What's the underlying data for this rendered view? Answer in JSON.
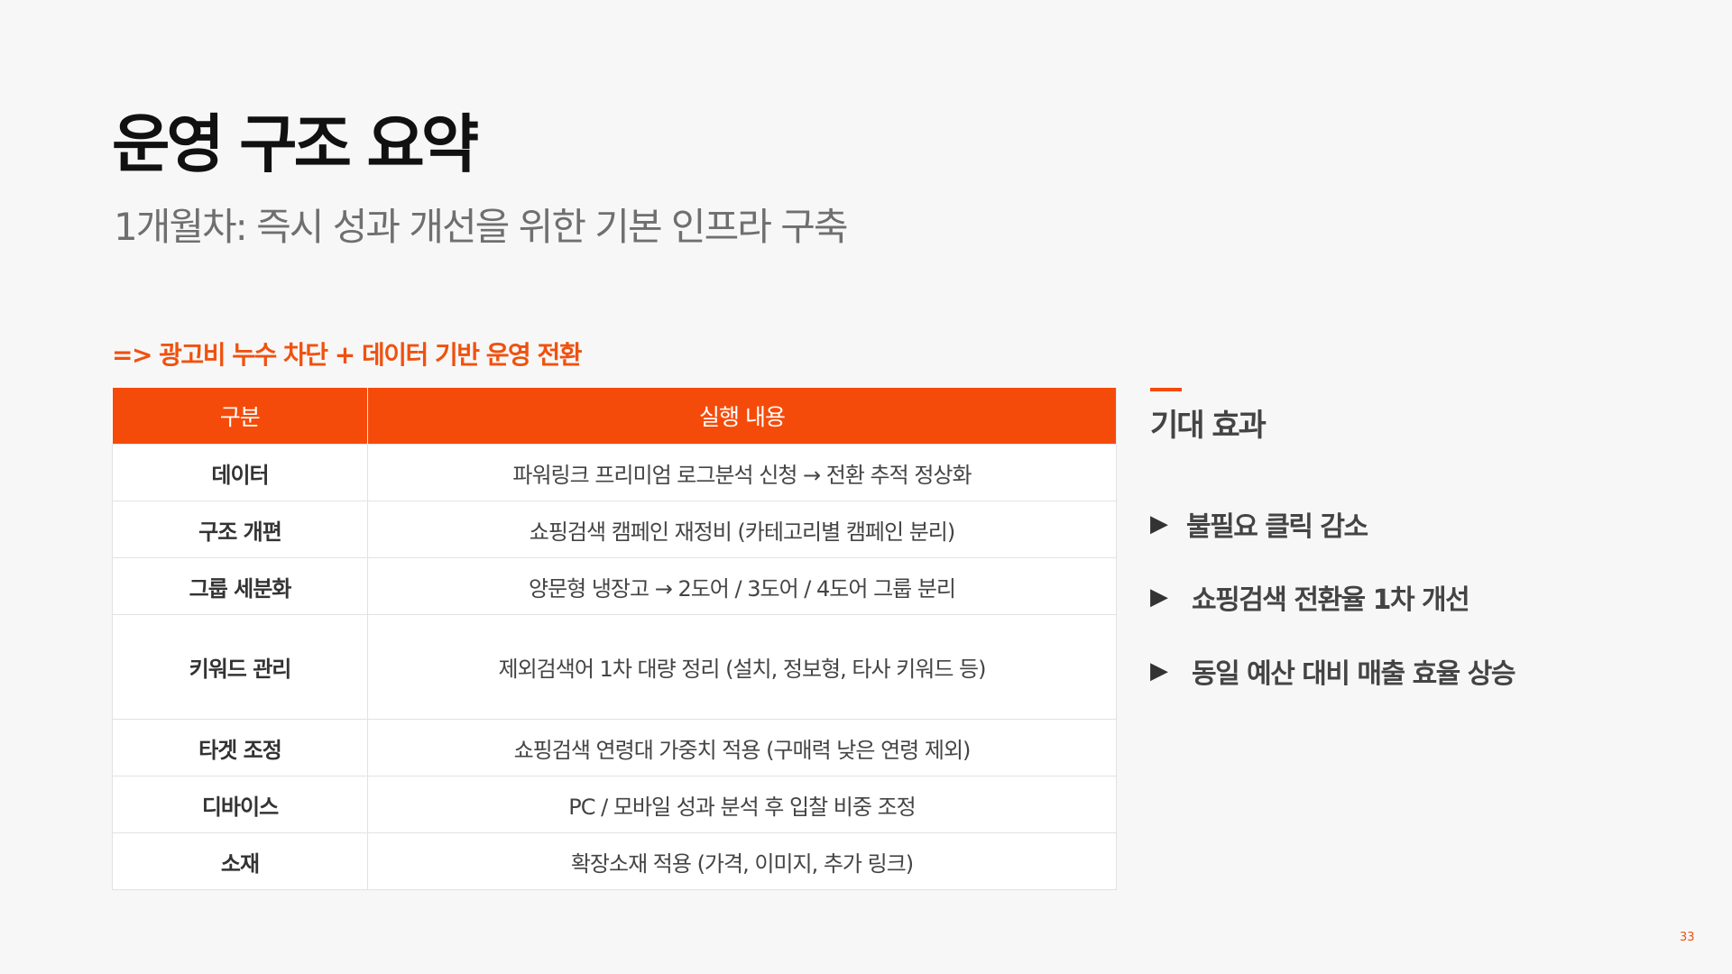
{
  "title": "운영 구조 요약",
  "subtitle": "1개월차: 즉시 성과 개선을 위한 기본 인프라 구축",
  "summary": "=> 광고비 누수 차단 + 데이터 기반 운영 전환",
  "table": {
    "headers": [
      "구분",
      "실행 내용"
    ],
    "rows": [
      {
        "category": "데이터",
        "content": "파워링크 프리미엄 로그분석 신청 → 전환 추적 정상화"
      },
      {
        "category": "구조 개편",
        "content": "쇼핑검색 캠페인 재정비 (카테고리별 캠페인 분리)"
      },
      {
        "category": "그룹 세분화",
        "content": "양문형 냉장고 → 2도어 / 3도어 / 4도어 그룹 분리"
      },
      {
        "category": "키워드 관리",
        "content": "제외검색어 1차 대량 정리 (설치, 정보형, 타사 키워드 등)"
      },
      {
        "category": "타겟 조정",
        "content": "쇼핑검색 연령대 가중치 적용 (구매력 낮은 연령 제외)"
      },
      {
        "category": "디바이스",
        "content": "PC / 모바일 성과 분석 후 입찰 비중 조정"
      },
      {
        "category": "소재",
        "content": "확장소재 적용 (가격, 이미지, 추가 링크)"
      }
    ]
  },
  "effects": {
    "title": "기대 효과",
    "items": [
      "불필요 클릭 감소",
      "쇼핑검색 전환율 1차 개선",
      "동일 예산 대비 매출 효율 상승"
    ],
    "bullet": "▶"
  },
  "page_number": "33",
  "colors": {
    "accent": "#f54b0a",
    "background": "#f7f7f7"
  }
}
